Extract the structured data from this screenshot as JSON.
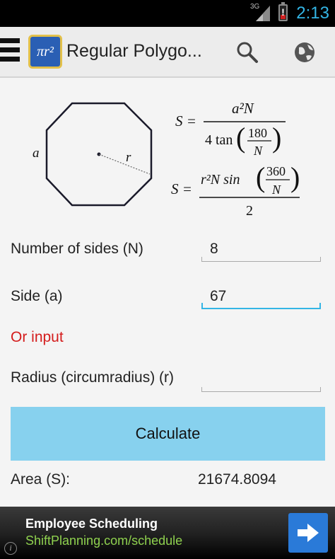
{
  "status_bar": {
    "network": "3G",
    "time": "2:13",
    "clock_color": "#33b5e5"
  },
  "app_bar": {
    "title": "Regular Polygo...",
    "app_icon_label": "πr²",
    "menu_icon": "hamburger-icon",
    "search_icon": "search-icon",
    "globe_icon": "globe-icon"
  },
  "diagram": {
    "side_label": "a",
    "radius_label": "r"
  },
  "formulas": {
    "area_lhs": "S =",
    "f1_numerator": "a²N",
    "f1_denominator_prefix": "4 tan",
    "f1_angle_numerator": "180",
    "f1_angle_denominator": "N",
    "f2_numerator_prefix": "r²N sin",
    "f2_angle_numerator": "360",
    "f2_angle_denominator": "N",
    "f2_denominator": "2"
  },
  "form": {
    "sides_label": "Number of sides (N)",
    "sides_value": "8",
    "side_label": "Side (a)",
    "side_value": "67",
    "or_input": "Or input",
    "radius_label": "Radius (circumradius) (r)",
    "radius_value": ""
  },
  "calculate_button": "Calculate",
  "result": {
    "label": "Area (S):",
    "value": "21674.8094"
  },
  "ad": {
    "title": "Employee Scheduling",
    "url": "ShiftPlanning.com/schedule",
    "info": "i",
    "arrow_icon": "arrow-right-icon",
    "accent": "#2a7ad8"
  },
  "colors": {
    "button_bg": "#87d1ee",
    "active_field": "#33b5e5",
    "or_input": "#d41c1c"
  }
}
